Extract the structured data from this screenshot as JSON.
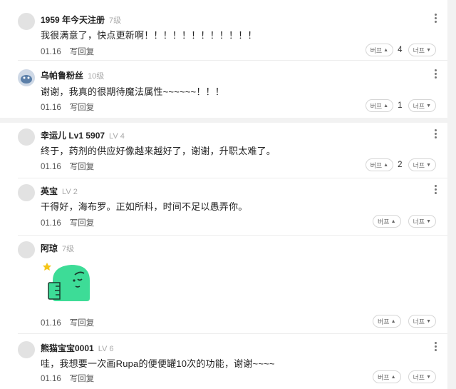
{
  "comments": [
    {
      "name": "1959 年今天注册",
      "level": "7级",
      "text": "我很满意了，快点更新啊！！！！！！！！！！！！",
      "date": "01.16",
      "reply": "写回复",
      "down": "버프",
      "count": "4",
      "up": "너프"
    },
    {
      "name": "乌帕鲁粉丝",
      "level": "10级",
      "text": "谢谢，我真的很期待魔法属性~~~~~~！！！",
      "date": "01.16",
      "reply": "写回复",
      "down": "버프",
      "count": "1",
      "up": "너프"
    },
    {
      "name": "幸运儿 Lv1 5907",
      "level": "LV 4",
      "text": "终于，药剂的供应好像越来越好了，谢谢，升职太难了。",
      "date": "01.16",
      "reply": "写回复",
      "down": "버프",
      "count": "2",
      "up": "너프"
    },
    {
      "name": "英宝",
      "level": "LV 2",
      "text": "干得好，海布罗。正如所料，时间不足以愚弄你。",
      "date": "01.16",
      "reply": "写回复",
      "down": "버프",
      "count": "",
      "up": "너프"
    },
    {
      "name": "阿琼",
      "level": "7级",
      "text": "",
      "date": "01.16",
      "reply": "写回复",
      "down": "버프",
      "count": "",
      "up": "너프",
      "sticker": "green-character-sticker"
    },
    {
      "name": "熊猫宝宝0001",
      "level": "LV 6",
      "text": "哇，我想要一次画Rupa的便便罐10次的功能，谢谢~~~~",
      "date": "01.16",
      "reply": "写回复",
      "down": "버프",
      "count": "",
      "up": "너프"
    }
  ],
  "colors": {
    "accent_sticker": "#3ddc97",
    "star": "#f5c518"
  }
}
